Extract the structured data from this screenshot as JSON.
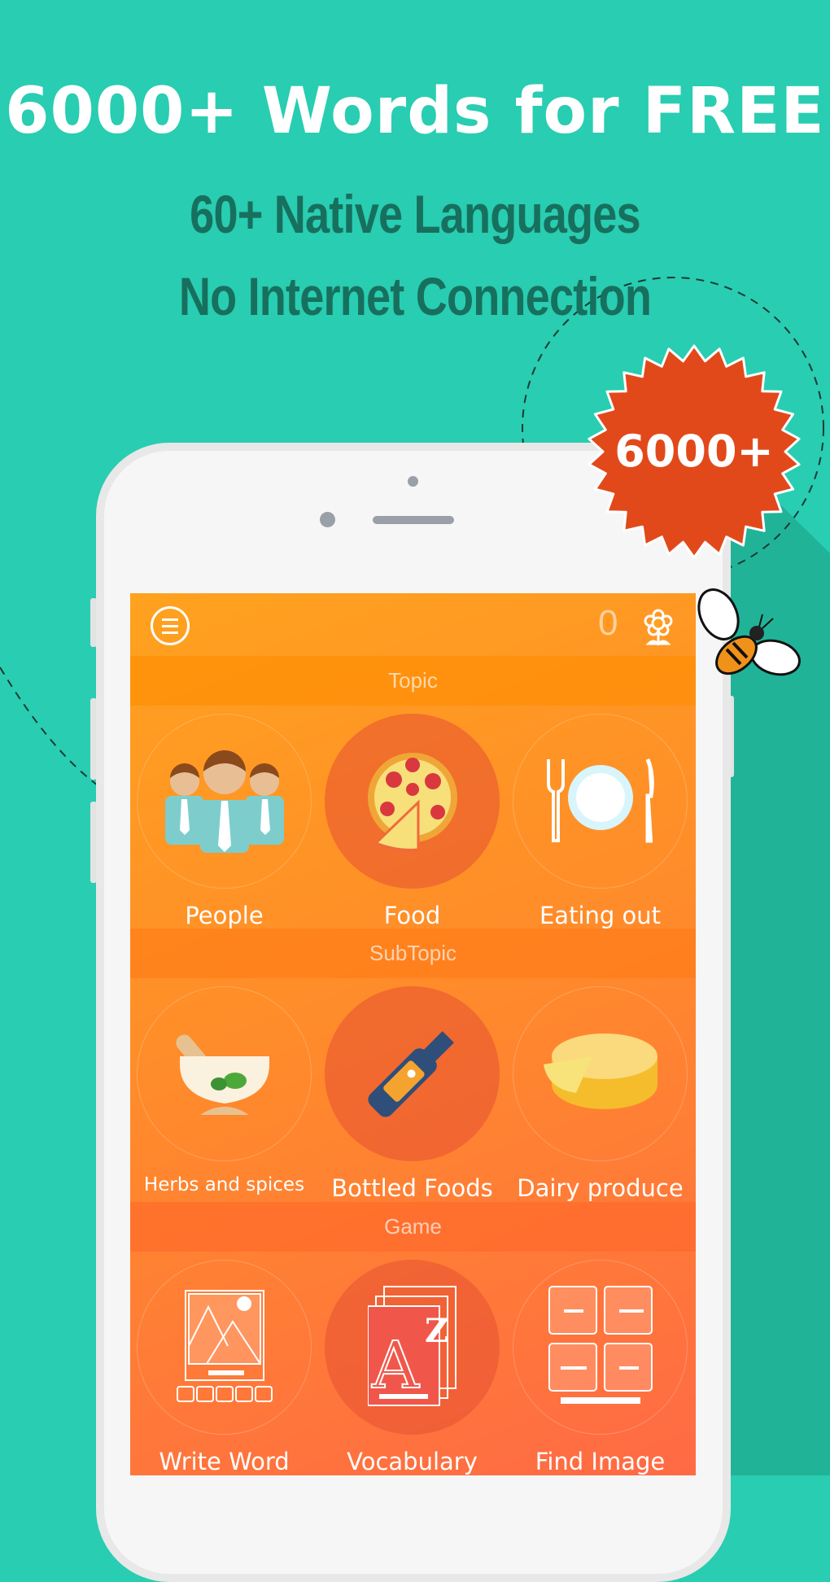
{
  "headline": "6000+ Words for FREE",
  "subheadlines": [
    "60+ Native Languages",
    "No Internet Connection"
  ],
  "badge": {
    "text": "6000+",
    "color": "#e2491a"
  },
  "colors": {
    "background": "#29cdb1",
    "subheadline": "#17705e",
    "header": "#ffa21e"
  },
  "app": {
    "header": {
      "menu_icon": "hamburger-menu-icon",
      "score": "0",
      "flower_icon": "flower-icon"
    },
    "sections": [
      {
        "title": "Topic",
        "items": [
          {
            "label": "People",
            "icon": "people-icon"
          },
          {
            "label": "Food",
            "icon": "pizza-icon",
            "selected": true
          },
          {
            "label": "Eating out",
            "icon": "plate-cutlery-icon"
          }
        ]
      },
      {
        "title": "SubTopic",
        "items": [
          {
            "label": "Herbs and spices",
            "icon": "mortar-pestle-icon"
          },
          {
            "label": "Bottled Foods",
            "icon": "bottle-icon",
            "selected": true
          },
          {
            "label": "Dairy produce",
            "icon": "cheese-icon"
          }
        ]
      },
      {
        "title": "Game",
        "items": [
          {
            "label": "Write Word",
            "icon": "write-word-icon"
          },
          {
            "label": "Vocabulary",
            "icon": "vocabulary-cards-icon",
            "selected": true
          },
          {
            "label": "Find Image",
            "icon": "find-image-grid-icon"
          }
        ]
      }
    ]
  }
}
